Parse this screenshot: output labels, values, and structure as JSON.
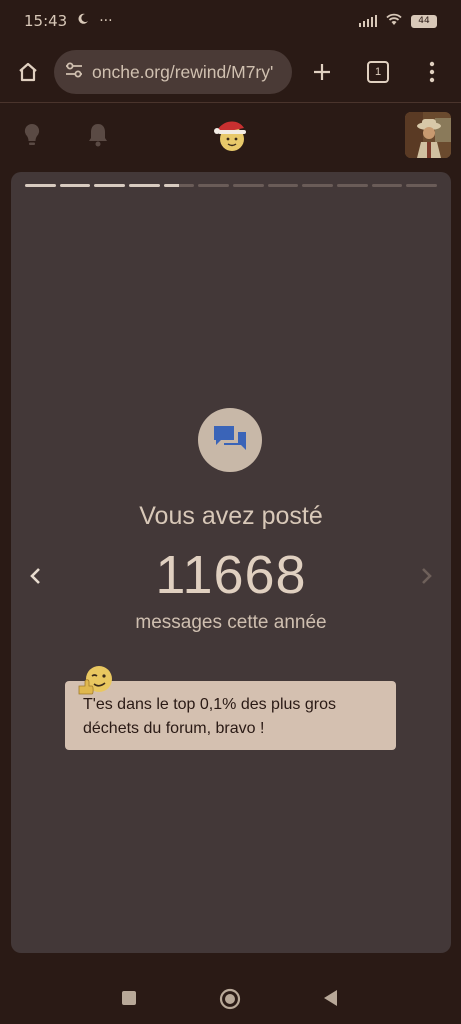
{
  "status_bar": {
    "time": "15:43",
    "moon_icon": "moon-icon",
    "more_dots": "···",
    "battery": "44"
  },
  "browser": {
    "url": "onche.org/rewind/M7ry'",
    "tab_count": "1"
  },
  "story": {
    "progress_total": 12,
    "progress_completed": 4,
    "progress_current_fraction": 0.5,
    "title": "Vous avez posté",
    "number": "11668",
    "subtitle": "messages cette année",
    "note": "T'es dans le top 0,1% des plus gros déchets du forum, bravo !"
  },
  "colors": {
    "message_icon": "#3a64b8",
    "card_bg": "#433838",
    "page_bg": "#2a1a15"
  }
}
